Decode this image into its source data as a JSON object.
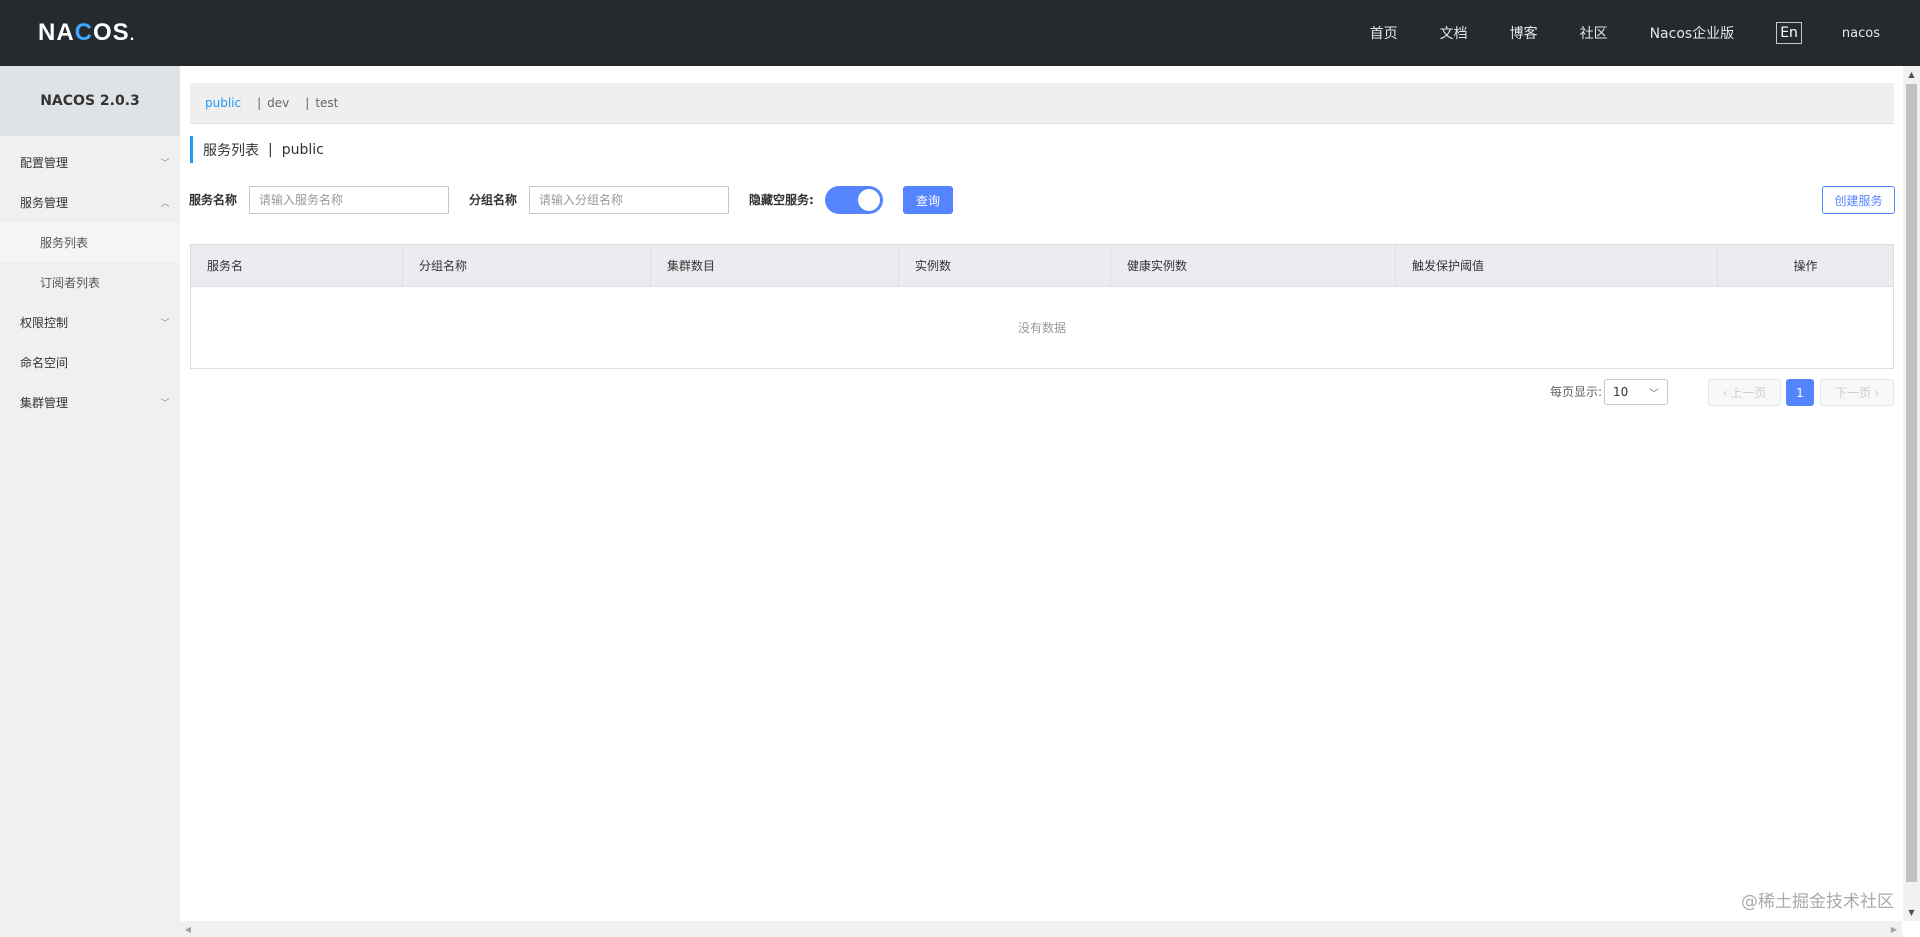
{
  "header": {
    "logo_text_a": "NA",
    "logo_text_b": "C",
    "logo_text_c": "OS",
    "logo_dot": ".",
    "nav": [
      "首页",
      "文档",
      "博客",
      "社区",
      "Nacos企业版"
    ],
    "lang": "En",
    "user": "nacos"
  },
  "sidebar": {
    "title": "NACOS 2.0.3",
    "items": [
      {
        "label": "配置管理",
        "chevron": "down"
      },
      {
        "label": "服务管理",
        "chevron": "up"
      },
      {
        "label": "服务列表",
        "sub": true,
        "active": true
      },
      {
        "label": "订阅者列表",
        "sub": true
      },
      {
        "label": "权限控制",
        "chevron": "down"
      },
      {
        "label": "命名空间"
      },
      {
        "label": "集群管理",
        "chevron": "down"
      }
    ]
  },
  "namespaces": {
    "items": [
      "public",
      "dev",
      "test"
    ],
    "separator": "|"
  },
  "page": {
    "title": "服务列表",
    "separator": "|",
    "namespace": "public"
  },
  "filters": {
    "service_label": "服务名称",
    "service_placeholder": "请输入服务名称",
    "group_label": "分组名称",
    "group_placeholder": "请输入分组名称",
    "hide_empty_label": "隐藏空服务:",
    "hide_empty_on": true,
    "query_button": "查询",
    "create_button": "创建服务"
  },
  "table": {
    "columns": [
      "服务名",
      "分组名称",
      "集群数目",
      "实例数",
      "健康实例数",
      "触发保护阈值",
      "操作"
    ],
    "empty_text": "没有数据"
  },
  "pagination": {
    "per_page_label": "每页显示:",
    "per_page_value": "10",
    "prev_label": "上一页",
    "next_label": "下一页",
    "current_page": "1"
  },
  "watermark": "@稀土掘金技术社区",
  "colors": {
    "header_bg": "#252a2f",
    "accent": "#5584ff",
    "link_active": "#209bfa",
    "sidebar_bg": "#eef0f2"
  }
}
